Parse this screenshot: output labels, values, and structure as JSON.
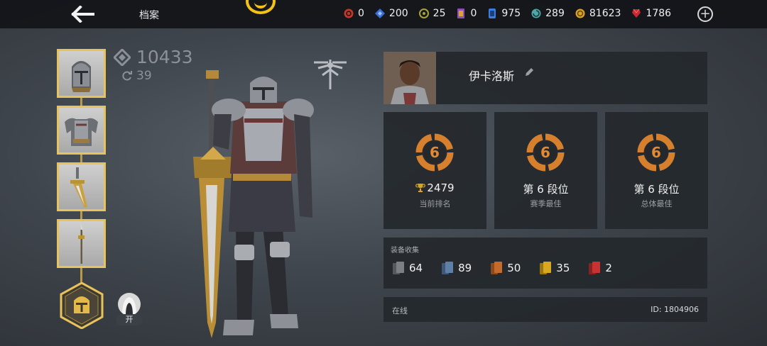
{
  "header": {
    "title": "档案",
    "back_icon": "arrow-left-icon",
    "emblem_icon": "gold-faction-emblem-icon",
    "currencies": [
      {
        "icon": "red-orb-icon",
        "value": "0",
        "color": "#c0392b"
      },
      {
        "icon": "blue-diamond-icon",
        "value": "200",
        "color": "#3a6fd8"
      },
      {
        "icon": "olive-sigil-icon",
        "value": "25",
        "color": "#a6a23a"
      },
      {
        "icon": "purple-ticket-icon",
        "value": "0",
        "color": "#8e4fb8"
      },
      {
        "icon": "blue-card-icon",
        "value": "975",
        "color": "#3b7de0"
      },
      {
        "icon": "teal-spiral-icon",
        "value": "289",
        "color": "#4fa6a9"
      },
      {
        "icon": "gold-coin-icon",
        "value": "81623",
        "color": "#d9a520"
      },
      {
        "icon": "red-gem-icon",
        "value": "1786",
        "color": "#c8282e"
      }
    ],
    "add_icon": "plus-circle-icon"
  },
  "equipment": {
    "slots": [
      {
        "name": "helmet-slot",
        "icon": "knight-helmet-icon"
      },
      {
        "name": "armor-slot",
        "icon": "plate-armor-icon"
      },
      {
        "name": "weapon-slot",
        "icon": "greatsword-icon"
      },
      {
        "name": "ranged-slot",
        "icon": "spear-icon"
      }
    ],
    "class_badge_icon": "knight-class-badge-icon",
    "toggle_label": "开"
  },
  "stats": {
    "power": "10433",
    "refresh": "39"
  },
  "profile": {
    "name": "伊卡洛斯",
    "edit_icon": "pencil-icon"
  },
  "ranks": [
    {
      "tier": "6",
      "value": "2479",
      "label": "当前排名",
      "has_trophy": true
    },
    {
      "tier": "6",
      "value": "第 6 段位",
      "label": "赛季最佳",
      "has_trophy": false
    },
    {
      "tier": "6",
      "value": "第 6 段位",
      "label": "总体最佳",
      "has_trophy": false
    }
  ],
  "collection": {
    "title": "装备收集",
    "items": [
      {
        "icon": "gray-card-icon",
        "count": "64",
        "color": "#7c7f84"
      },
      {
        "icon": "blue-card-icon",
        "count": "89",
        "color": "#5d7fa8"
      },
      {
        "icon": "orange-card-icon",
        "count": "50",
        "color": "#c46a2a"
      },
      {
        "icon": "gold-card-icon",
        "count": "35",
        "color": "#d8a81e"
      },
      {
        "icon": "red-card-icon",
        "count": "2",
        "color": "#c83232"
      }
    ]
  },
  "footer": {
    "status": "在线",
    "player_id": "ID: 1804906"
  },
  "colors": {
    "accent_gold": "#e8c25a",
    "rank_orange": "#d6802e",
    "panel_bg": "#24282d"
  }
}
